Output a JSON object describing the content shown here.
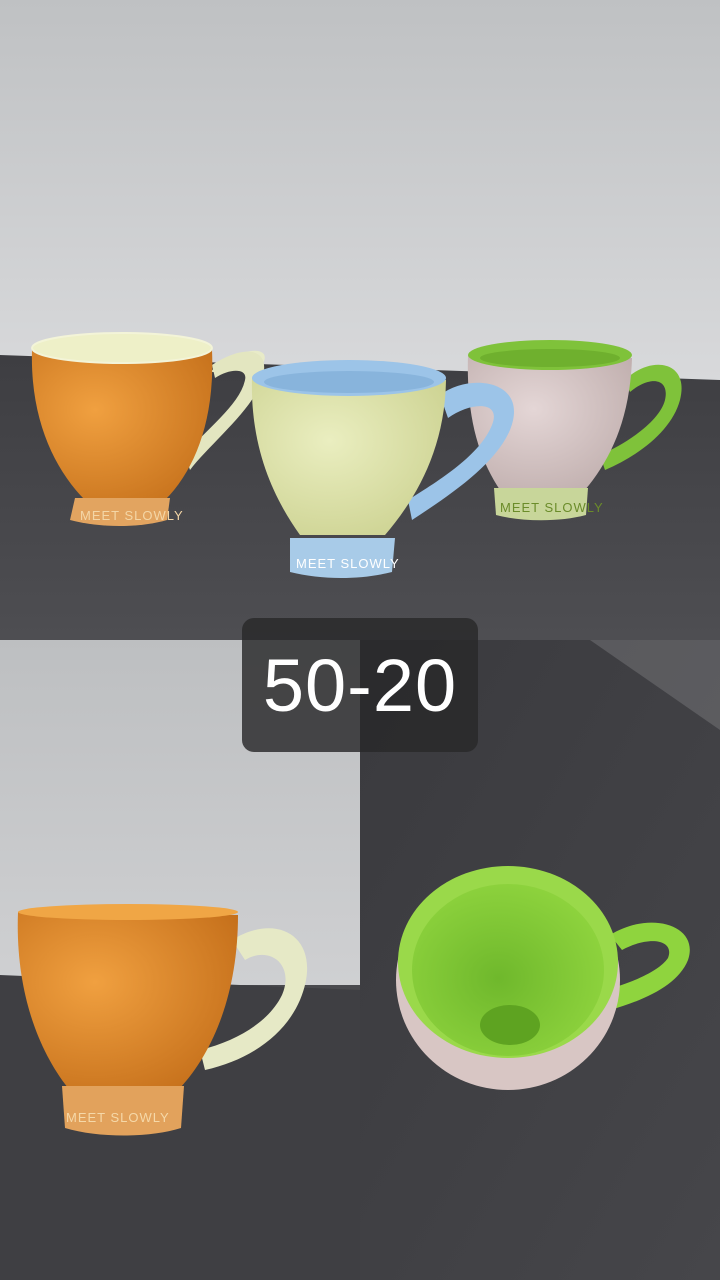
{
  "overlay": {
    "price_label": "50-20"
  },
  "mugs": [
    {
      "name": "orange",
      "body": "#e08a2a",
      "inner": "#eef0c8",
      "handle": "#e8ebc8",
      "base_text": "MEET SLOWLY"
    },
    {
      "name": "yellow-green",
      "body": "#dfe4a6",
      "inner": "#9cc4e8",
      "handle": "#9cc4e8",
      "base_text": "MEET SLOWLY"
    },
    {
      "name": "pink",
      "body": "#d6c4c4",
      "inner": "#7fc23a",
      "handle": "#7fc23a",
      "base_text": "MEET SLOWLY"
    }
  ],
  "colors": {
    "wall": "#c9cacb",
    "table": "#47474b"
  }
}
